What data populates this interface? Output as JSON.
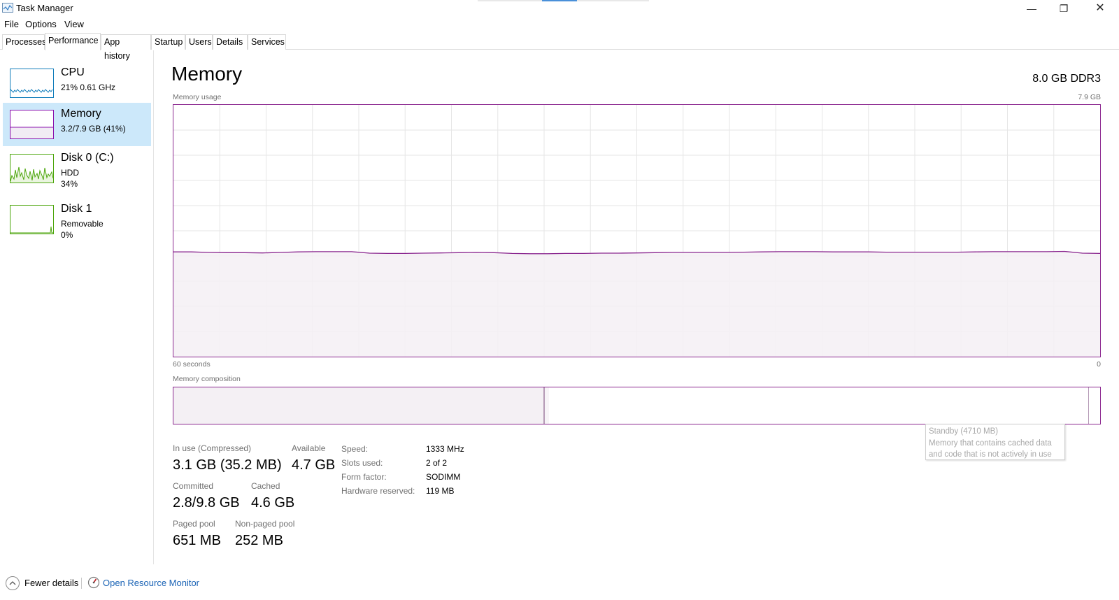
{
  "window": {
    "title": "Task Manager",
    "minimize_icon": "minimize-icon",
    "maximize_icon": "restore-icon",
    "close_icon": "close-icon",
    "minimize_glyph": "—",
    "maximize_glyph": "❐",
    "close_glyph": "✕"
  },
  "menu": [
    "File",
    "Options",
    "View"
  ],
  "tabs": [
    {
      "label": "Processes",
      "active": false
    },
    {
      "label": "Performance",
      "active": true
    },
    {
      "label": "App history",
      "active": false
    },
    {
      "label": "Startup",
      "active": false
    },
    {
      "label": "Users",
      "active": false
    },
    {
      "label": "Details",
      "active": false
    },
    {
      "label": "Services",
      "active": false
    }
  ],
  "resources": [
    {
      "name": "CPU",
      "lines": [
        "21% 0.61 GHz"
      ],
      "color": "#117dbb",
      "selected": false
    },
    {
      "name": "Memory",
      "lines": [
        "3.2/7.9 GB (41%)"
      ],
      "color": "#8b12ae",
      "selected": true
    },
    {
      "name": "Disk 0 (C:)",
      "lines": [
        "HDD",
        "34%"
      ],
      "color": "#4da60c",
      "selected": false
    },
    {
      "name": "Disk 1",
      "lines": [
        "Removable",
        "0%"
      ],
      "color": "#4da60c",
      "selected": false
    }
  ],
  "main": {
    "title": "Memory",
    "spec": "8.0 GB DDR3",
    "usage_label": "Memory usage",
    "usage_max": "7.9 GB",
    "time_left": "60 seconds",
    "time_right": "0",
    "composition_label": "Memory composition"
  },
  "composition": {
    "in_use_fraction": 0.4,
    "modified_fraction": 0.005,
    "standby_fraction": 0.583
  },
  "tooltip": {
    "title": "Standby (4710 MB)",
    "line1": "Memory that contains cached data",
    "line2": "and code that is not actively in use"
  },
  "stats": {
    "in_use_label": "In use (Compressed)",
    "in_use_value": "3.1 GB (35.2 MB)",
    "available_label": "Available",
    "available_value": "4.7 GB",
    "committed_label": "Committed",
    "committed_value": "2.8/9.8 GB",
    "cached_label": "Cached",
    "cached_value": "4.6 GB",
    "paged_label": "Paged pool",
    "paged_value": "651 MB",
    "nonpaged_label": "Non-paged pool",
    "nonpaged_value": "252 MB"
  },
  "properties": [
    {
      "label": "Speed:",
      "value": "1333 MHz"
    },
    {
      "label": "Slots used:",
      "value": "2 of 2"
    },
    {
      "label": "Form factor:",
      "value": "SODIMM"
    },
    {
      "label": "Hardware reserved:",
      "value": "119 MB"
    }
  ],
  "footer": {
    "fewer_details": "Fewer details",
    "resource_monitor": "Open Resource Monitor"
  },
  "colors": {
    "memory_accent": "#8b2890",
    "memory_fill": "#f4f0f4",
    "grid": "#e6e6e6",
    "selected_bg": "#cce8fa",
    "link": "#1a63b5"
  },
  "chart_data": {
    "type": "area",
    "series": [
      {
        "values": [
          41.6,
          41.6,
          41.4,
          41.3,
          41.3,
          41.2,
          41.4,
          41.6,
          41.7,
          41.7,
          41.7,
          41.1,
          41.0,
          41.0,
          41.1,
          41.2,
          41.3,
          41.4,
          41.3,
          41.0,
          40.9,
          40.9,
          41.0,
          41.0,
          41.1,
          41.1,
          41.2,
          41.3,
          41.4,
          41.4,
          41.4,
          41.4,
          41.5,
          41.6,
          41.7,
          41.7,
          41.7,
          41.6,
          41.6,
          41.6,
          41.5,
          41.5,
          41.5,
          41.5,
          41.5,
          41.6,
          41.7,
          41.7,
          41.7,
          41.7,
          41.8,
          41.1,
          41.0
        ]
      }
    ],
    "ylim": [
      0,
      100
    ],
    "grid": true
  }
}
